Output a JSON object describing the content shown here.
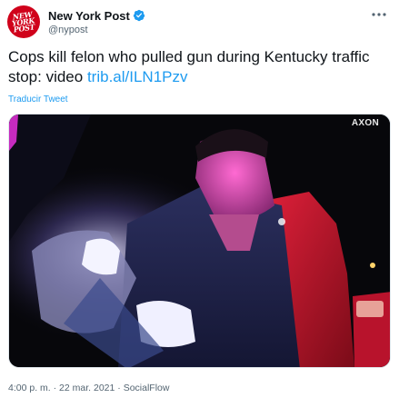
{
  "account": {
    "display_name": "New York Post",
    "handle": "@nypost",
    "avatar_text": "NEW YORK POST",
    "verified": true
  },
  "icons": {
    "verified": "verified-badge-icon",
    "more": "more-options-icon"
  },
  "tweet": {
    "text": "Cops kill felon who pulled gun during Kentucky traffic stop: video ",
    "link": "trib.al/ILN1Pzv",
    "translate_label": "Traducir Tweet"
  },
  "media": {
    "watermark": "AXON"
  },
  "meta": {
    "time": "4:00 p. m.",
    "separator": "·",
    "date": "22 mar. 2021",
    "source": "SocialFlow"
  },
  "colors": {
    "accent": "#1d9bf0",
    "avatar_bg": "#d0021b",
    "text": "#0f1419",
    "muted": "#536471"
  }
}
